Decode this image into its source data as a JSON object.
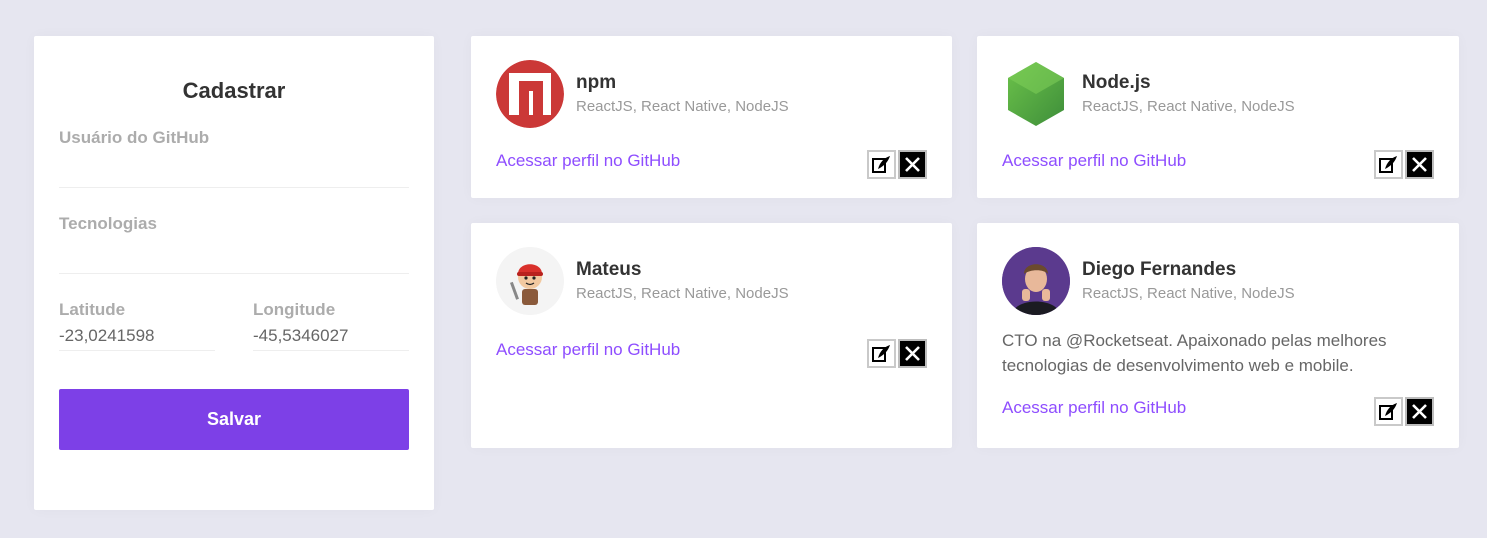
{
  "form": {
    "title": "Cadastrar",
    "github_user_label": "Usuário do GitHub",
    "github_user_value": "",
    "techs_label": "Tecnologias",
    "techs_value": "",
    "latitude_label": "Latitude",
    "latitude_value": "-23,0241598",
    "longitude_label": "Longitude",
    "longitude_value": "-45,5346027",
    "save_label": "Salvar"
  },
  "devs": [
    {
      "name": "npm",
      "techs": "ReactJS, React Native, NodeJS",
      "bio": "",
      "link_label": "Acessar perfil no GitHub",
      "avatar_icon": "npm-logo-icon"
    },
    {
      "name": "Node.js",
      "techs": "ReactJS, React Native, NodeJS",
      "bio": "",
      "link_label": "Acessar perfil no GitHub",
      "avatar_icon": "nodejs-logo-icon"
    },
    {
      "name": "Mateus",
      "techs": "ReactJS, React Native, NodeJS",
      "bio": "",
      "link_label": "Acessar perfil no GitHub",
      "avatar_icon": "cartoon-avatar-icon"
    },
    {
      "name": "Diego Fernandes",
      "techs": "ReactJS, React Native, NodeJS",
      "bio": "CTO na @Rocketseat. Apaixonado pelas melhores tecnologias de desenvolvimento web e mobile.",
      "link_label": "Acessar perfil no GitHub",
      "avatar_icon": "person-photo-avatar"
    }
  ],
  "colors": {
    "background": "#e6e6f0",
    "accent": "#7d40e7",
    "link": "#8e4dff",
    "npm_red": "#cb3837",
    "node_green": "#5fa04e"
  }
}
